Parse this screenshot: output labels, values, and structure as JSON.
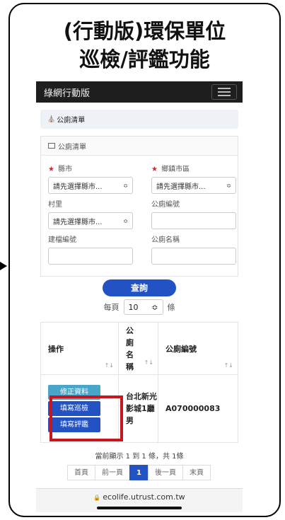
{
  "heading": {
    "line1": "(行動版)環保單位",
    "line2": "巡檢/評鑑功能"
  },
  "navbar": {
    "brand": "綠網行動版",
    "menu_icon": "hamburger-icon"
  },
  "breadcrumb": {
    "icon": "home-icon",
    "label": "公廁清單"
  },
  "panel": {
    "icon": "grid-icon",
    "title": "公廁清單"
  },
  "form": {
    "county_label": "縣市",
    "county_value": "請先選擇縣市...",
    "township_label": "鄉鎮市區",
    "township_value": "請先選擇縣市...",
    "village_label": "村里",
    "village_value": "請先選擇縣市...",
    "toilet_no_label": "公廁編號",
    "toilet_no_value": "",
    "building_no_label": "建檔編號",
    "building_no_value": "",
    "toilet_name_label": "公廁名稱",
    "toilet_name_value": "",
    "required_mark": "★",
    "chevron": "≎"
  },
  "search_button": "查詢",
  "pagesize": {
    "prefix": "每頁",
    "value": "10",
    "suffix": "條"
  },
  "table": {
    "headers": {
      "actions": "操作",
      "name": "公廁名稱",
      "code": "公廁編號"
    },
    "sort_glyph": "↑↓",
    "rows": [
      {
        "btn_edit": "修正資料",
        "btn_inspect": "填寫巡檢",
        "btn_evaluate": "填寫評鑑",
        "name": "台北新光影城1廳男",
        "code": "A070000083"
      }
    ]
  },
  "summary": "當前顯示 1 到 1 條，共 1條",
  "pager": {
    "first": "首頁",
    "prev": "前一頁",
    "current": "1",
    "next": "後一頁",
    "last": "末頁"
  },
  "urlbar": {
    "lock_icon": "lock-icon",
    "url": "ecolife.utrust.com.tw"
  },
  "colors": {
    "primary": "#2252c4",
    "highlight": "#c8161e",
    "navbar": "#1e1e1e",
    "edit_button": "#4aa6c9"
  }
}
